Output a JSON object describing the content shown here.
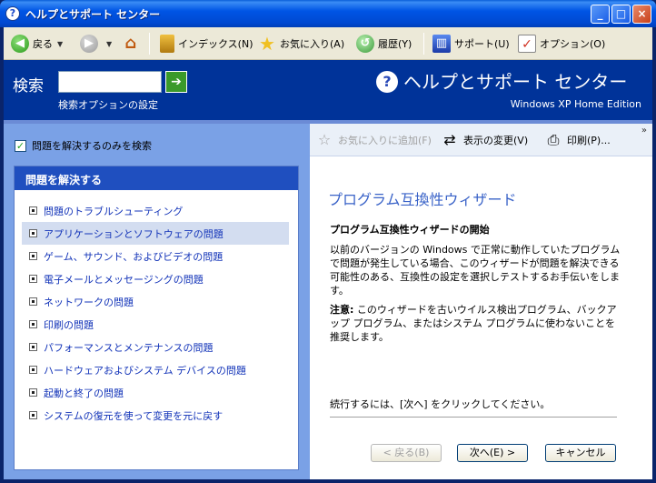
{
  "window": {
    "title": "ヘルプとサポート センター",
    "minimize": "_",
    "maximize": "□",
    "close": "×"
  },
  "toolbar": {
    "back": "戻る",
    "index": "インデックス(N)",
    "favorites": "お気に入り(A)",
    "history": "履歴(Y)",
    "support": "サポート(U)",
    "options": "オプション(O)"
  },
  "banner": {
    "search_label": "検索",
    "search_value": "",
    "search_options": "検索オプションの設定",
    "title": "ヘルプとサポート センター",
    "edition": "Windows XP Home Edition"
  },
  "left": {
    "checkbox_label": "問題を解決するのみを検索",
    "panel_title": "問題を解決する",
    "items": [
      {
        "label": "問題のトラブルシューティング"
      },
      {
        "label": "アプリケーションとソフトウェアの問題"
      },
      {
        "label": "ゲーム、サウンド、およびビデオの問題"
      },
      {
        "label": "電子メールとメッセージングの問題"
      },
      {
        "label": "ネットワークの問題"
      },
      {
        "label": "印刷の問題"
      },
      {
        "label": "パフォーマンスとメンテナンスの問題"
      },
      {
        "label": "ハードウェアおよびシステム デバイスの問題"
      },
      {
        "label": "起動と終了の問題"
      },
      {
        "label": "システムの復元を使って変更を元に戻す"
      }
    ]
  },
  "right": {
    "tool_add_fav": "お気に入りに追加(F)",
    "tool_view": "表示の変更(V)",
    "tool_print": "印刷(P)...",
    "wizard_title": "プログラム互換性ウィザード",
    "wizard_subtitle": "プログラム互換性ウィザードの開始",
    "wizard_body": "以前のバージョンの Windows で正常に動作していたプログラムで問題が発生している場合、このウィザードが問題を解決できる可能性のある、互換性の設定を選択しテストするお手伝いをします。",
    "note_label": "注意:",
    "note_text": "このウィザードを古いウイルス検出プログラム、バックアップ プログラム、またはシステム プログラムに使わないことを推奨します。",
    "continue_text": "続行するには、[次へ] をクリックしてください。",
    "btn_back": "< 戻る(B)",
    "btn_next": "次へ(E) >",
    "btn_cancel": "キャンセル"
  }
}
